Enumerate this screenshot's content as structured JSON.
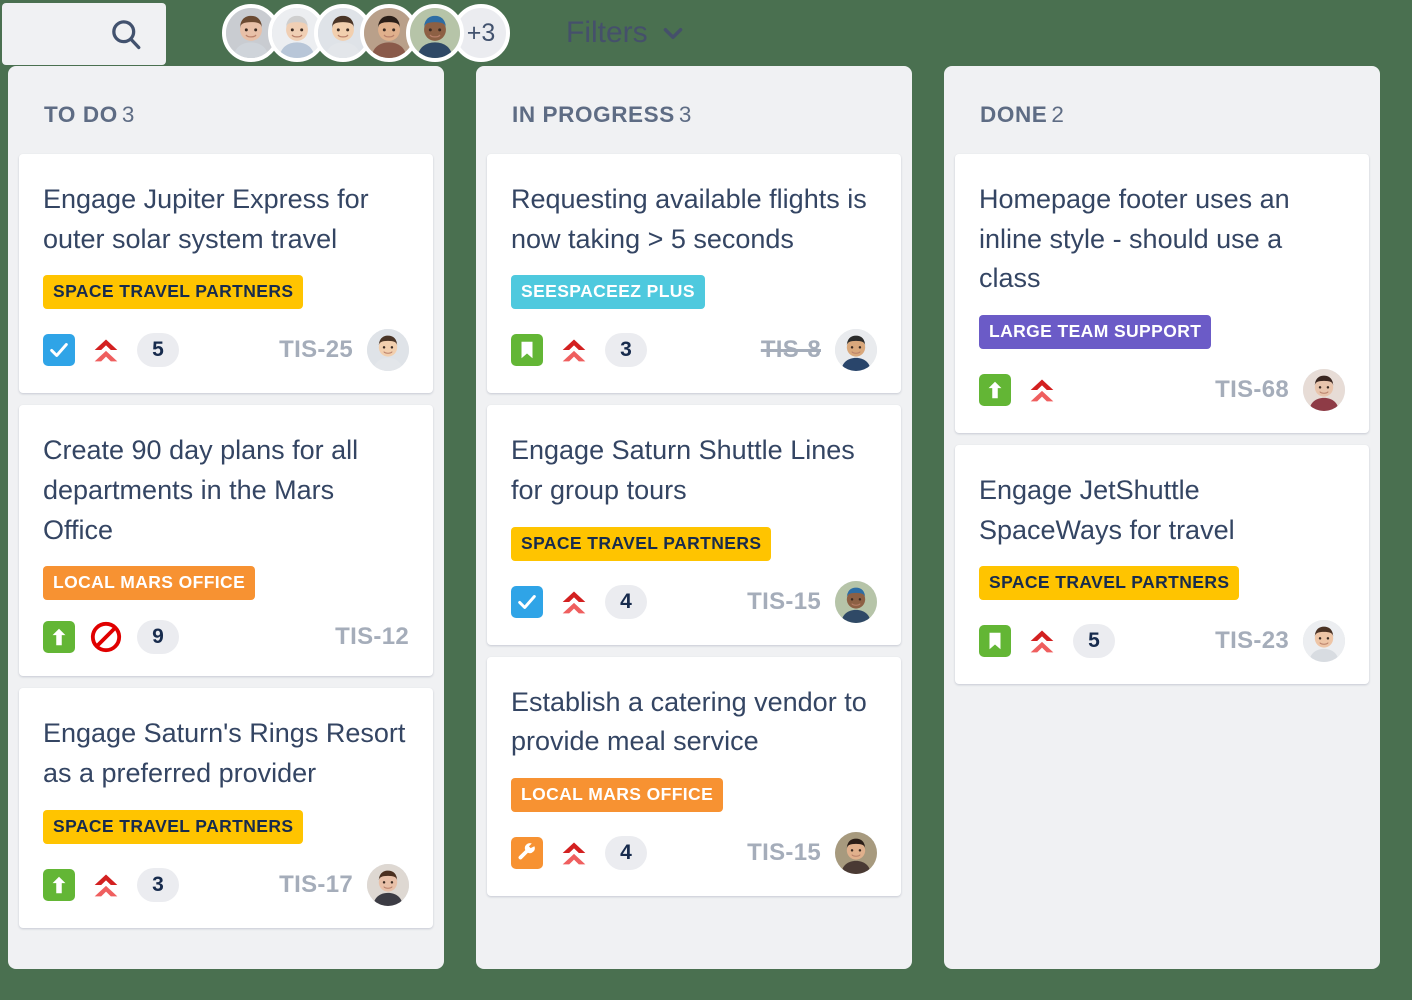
{
  "header": {
    "search": {
      "placeholder": "",
      "value": "",
      "icon": "search-icon"
    },
    "avatars": {
      "overflow_label": "+3",
      "people": [
        {
          "name": "avatar-1",
          "skin": "#e8c0a8",
          "hair": "#6b4a32",
          "shirt": "#cfd4da",
          "bg": "#c9ccd1"
        },
        {
          "name": "avatar-2",
          "skin": "#f0cfb4",
          "hair": "#cfcfcf",
          "shirt": "#b8c6d8",
          "bg": "#eceef1"
        },
        {
          "name": "avatar-3",
          "skin": "#f2cfae",
          "hair": "#4a3527",
          "shirt": "#e3e6ea",
          "bg": "#dfe3e8"
        },
        {
          "name": "avatar-4",
          "skin": "#e0b08c",
          "hair": "#2a1e18",
          "shirt": "#8a5a4a",
          "bg": "#b9a08a"
        },
        {
          "name": "avatar-5",
          "skin": "#8d6044",
          "hair": "#2e6da4",
          "shirt": "#2f4966",
          "bg": "#b6c4a8"
        }
      ]
    },
    "filters": {
      "label": "Filters",
      "icon": "chevron-down-icon"
    }
  },
  "colors": {
    "page_background": "#4a7050",
    "column_background": "#f0f1f3",
    "card_background": "#ffffff",
    "title_text": "#344563",
    "muted_text": "#5e6c84",
    "issue_key": "#a5adba",
    "epic_space_travel": "#ffc400",
    "epic_local_mars": "#f79232",
    "epic_seespaceez": "#4ec9de",
    "epic_large_team": "#6b5bc7",
    "type_story_green": "#63b635",
    "type_task_blue": "#2fa4e7",
    "type_bug_orange": "#f79232",
    "priority_red": "#e03131",
    "blocker_red": "#e00000"
  },
  "columns": [
    {
      "name": "todo",
      "title": "TO DO",
      "count": "3",
      "cards": [
        {
          "title": "Engage Jupiter Express for outer solar system travel",
          "epic": {
            "label": "SPACE TRAVEL PARTNERS",
            "bg": "#ffc400",
            "fg": "#172b4d"
          },
          "type_icon": "task-check-icon",
          "type_bg": "#2fa4e7",
          "priority_icon": "priority-highest-icon",
          "estimate": "5",
          "key": "TIS-25",
          "key_struck": false,
          "has_avatar": true,
          "avatar": {
            "skin": "#f2cfae",
            "hair": "#4a3527",
            "shirt": "#e3e6ea",
            "bg": "#dfe3e8"
          }
        },
        {
          "title": "Create 90 day plans for all departments in the Mars Office",
          "epic": {
            "label": "LOCAL MARS OFFICE",
            "bg": "#f79232",
            "fg": "#ffffff"
          },
          "type_icon": "improvement-arrow-icon",
          "type_bg": "#63b635",
          "priority_icon": "blocker-icon",
          "estimate": "9",
          "key": "TIS-12",
          "key_struck": false,
          "has_avatar": false,
          "avatar": null
        },
        {
          "title": "Engage Saturn's Rings Resort as a preferred provider",
          "epic": {
            "label": "SPACE TRAVEL PARTNERS",
            "bg": "#ffc400",
            "fg": "#172b4d"
          },
          "type_icon": "improvement-arrow-icon",
          "type_bg": "#63b635",
          "priority_icon": "priority-highest-icon",
          "estimate": "3",
          "key": "TIS-17",
          "key_struck": false,
          "has_avatar": true,
          "avatar": {
            "skin": "#e8c0a8",
            "hair": "#4a3020",
            "shirt": "#3c3c44",
            "bg": "#ded8d2"
          }
        }
      ]
    },
    {
      "name": "in-progress",
      "title": "IN PROGRESS",
      "count": "3",
      "cards": [
        {
          "title": "Requesting available flights is now taking > 5 seconds",
          "epic": {
            "label": "SEESPACEEZ PLUS",
            "bg": "#4ec9de",
            "fg": "#ffffff"
          },
          "type_icon": "story-bookmark-icon",
          "type_bg": "#63b635",
          "priority_icon": "priority-highest-icon",
          "estimate": "3",
          "key": "TIS-8",
          "key_struck": true,
          "has_avatar": true,
          "avatar": {
            "skin": "#d9a87c",
            "hair": "#2b2b2b",
            "shirt": "#29456b",
            "bg": "#e9ebee"
          }
        },
        {
          "title": "Engage Saturn Shuttle Lines for group tours",
          "epic": {
            "label": "SPACE TRAVEL PARTNERS",
            "bg": "#ffc400",
            "fg": "#172b4d"
          },
          "type_icon": "task-check-icon",
          "type_bg": "#2fa4e7",
          "priority_icon": "priority-highest-icon",
          "estimate": "4",
          "key": "TIS-15",
          "key_struck": false,
          "has_avatar": true,
          "avatar": {
            "skin": "#8d6044",
            "hair": "#2e6da4",
            "shirt": "#2f4966",
            "bg": "#b6c4a8"
          }
        },
        {
          "title": "Establish a catering vendor to provide meal service",
          "epic": {
            "label": "LOCAL MARS OFFICE",
            "bg": "#f79232",
            "fg": "#ffffff"
          },
          "type_icon": "bug-wrench-icon",
          "type_bg": "#f79232",
          "priority_icon": "priority-highest-icon",
          "estimate": "4",
          "key": "TIS-15",
          "key_struck": false,
          "has_avatar": true,
          "avatar": {
            "skin": "#e0b08c",
            "hair": "#2a1e18",
            "shirt": "#4a3a34",
            "bg": "#a79a7e"
          }
        }
      ]
    },
    {
      "name": "done",
      "title": "DONE",
      "count": "2",
      "cards": [
        {
          "title": "Homepage footer uses an inline style - should use a class",
          "epic": {
            "label": "LARGE TEAM SUPPORT",
            "bg": "#6b5bc7",
            "fg": "#ffffff"
          },
          "type_icon": "improvement-arrow-icon",
          "type_bg": "#63b635",
          "priority_icon": "priority-highest-icon",
          "estimate": "",
          "key": "TIS-68",
          "key_struck": false,
          "has_avatar": true,
          "avatar": {
            "skin": "#e8c4ac",
            "hair": "#3a2620",
            "shirt": "#8e3b46",
            "bg": "#e7dcd6"
          }
        },
        {
          "title": "Engage JetShuttle SpaceWays for travel",
          "epic": {
            "label": "SPACE TRAVEL PARTNERS",
            "bg": "#ffc400",
            "fg": "#172b4d"
          },
          "type_icon": "story-bookmark-icon",
          "type_bg": "#63b635",
          "priority_icon": "priority-highest-icon",
          "estimate": "5",
          "key": "TIS-23",
          "key_struck": false,
          "has_avatar": true,
          "avatar": {
            "skin": "#eec5a6",
            "hair": "#4a3224",
            "shirt": "#d8dce1",
            "bg": "#eceef1"
          }
        }
      ]
    }
  ]
}
